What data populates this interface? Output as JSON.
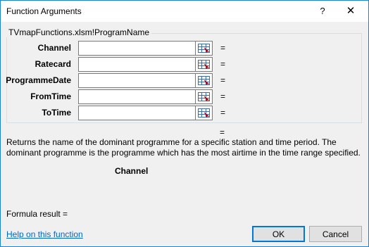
{
  "window": {
    "title": "Function Arguments",
    "help_glyph": "?",
    "close_glyph": "✕"
  },
  "function_group": {
    "label": "TVmapFunctions.xlsm!ProgramName"
  },
  "arguments": [
    {
      "label": "Channel",
      "value": "",
      "result": "="
    },
    {
      "label": "Ratecard",
      "value": "",
      "result": "="
    },
    {
      "label": "ProgrammeDate",
      "value": "",
      "result": "="
    },
    {
      "label": "FromTime",
      "value": "",
      "result": "="
    },
    {
      "label": "ToTime",
      "value": "",
      "result": "="
    }
  ],
  "function_result_eq": "=",
  "description": "Returns the name of the dominant programme for a specific station and time period. The dominant programme is the programme which has the most airtime in the time range specified.",
  "argument_description_name": "Channel",
  "formula_result": "Formula result =",
  "help_link": "Help on this function",
  "buttons": {
    "ok": "OK",
    "cancel": "Cancel"
  },
  "colors": {
    "accent": "#0078d7",
    "link": "#0066cc",
    "window_border": "#1883d7"
  }
}
